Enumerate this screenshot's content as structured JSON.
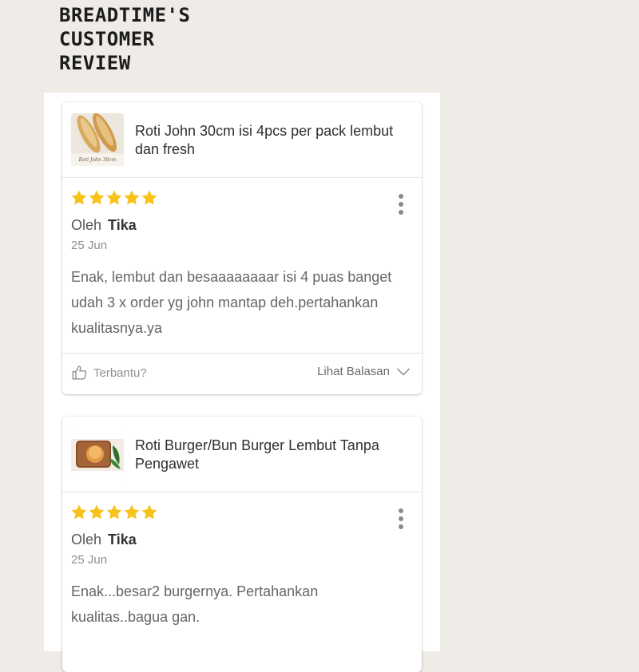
{
  "header": {
    "title_lines": [
      "BREADTIME'S",
      "CUSTOMER",
      "REVIEW"
    ]
  },
  "colors": {
    "star": "#f7c31a",
    "background": "#efebe7"
  },
  "reviews": [
    {
      "product_name": "Roti John 30cm isi 4pcs per pack lembut dan fresh",
      "product_thumb_caption": "Roti John 30cm",
      "rating": 5,
      "by_prefix": "Oleh",
      "reviewer": "Tika",
      "date": "25 Jun",
      "text": "Enak, lembut dan besaaaaaaaar isi 4 puas banget udah 3 x order yg john mantap deh.pertahankan kualitasnya.ya",
      "helpful_label": "Terbantu?",
      "replies_label": "Lihat Balasan"
    },
    {
      "product_name": "Roti Burger/Bun Burger Lembut Tanpa Pengawet",
      "rating": 5,
      "by_prefix": "Oleh",
      "reviewer": "Tika",
      "date": "25 Jun",
      "text": "Enak...besar2 burgernya. Pertahankan kualitas..bagua gan."
    }
  ]
}
